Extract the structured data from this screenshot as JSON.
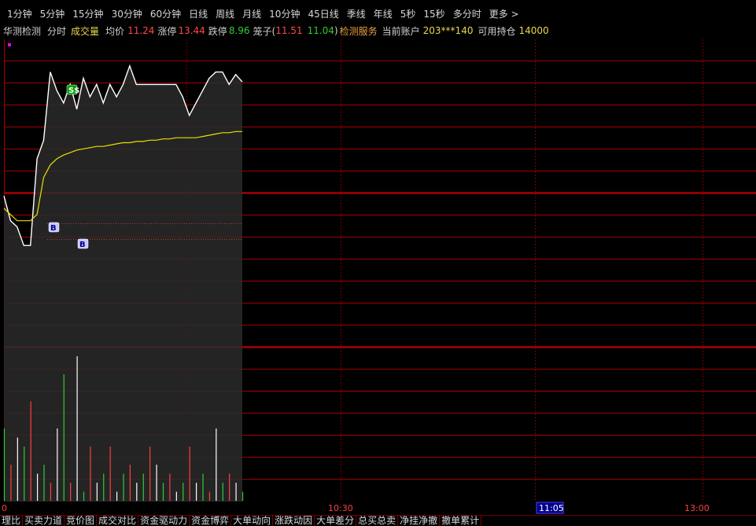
{
  "period_bar": [
    "1分钟",
    "5分钟",
    "15分钟",
    "30分钟",
    "60分钟",
    "日线",
    "周线",
    "月线",
    "10分钟",
    "45日线",
    "季线",
    "年线",
    "5秒",
    "15秒",
    "多分时",
    "更多 >"
  ],
  "info_bar": {
    "indicator": "华测检测",
    "mode": "分时",
    "volume_label": "成交量",
    "avg_label": "均价",
    "avg_value": "11.24",
    "limit_up_label": "涨停",
    "limit_up_value": "13.44",
    "limit_down_label": "跌停",
    "limit_down_value": "8.96",
    "cage_label": "笼子(",
    "cage_low": "11.51",
    "cage_high": "11.04",
    "cage_close": ")",
    "service": "检测服务",
    "account_label": "当前账户",
    "account_value": "203***140",
    "position_label": "可用持仓",
    "position_value": "14000"
  },
  "chart_markers": {
    "buy1": "B",
    "buy2": "B",
    "sell": "S$"
  },
  "time_axis": {
    "start": "0",
    "t1030": "10:30",
    "t1105": "11:05",
    "t1300": "13:00"
  },
  "bottom_tabs": [
    "理比",
    "买卖力道",
    "竞价图",
    "成交对比",
    "资金驱动力",
    "资金博弈",
    "大单动向",
    "涨跌动因",
    "大单差分",
    "总买总卖",
    "净挂净撤",
    "撤单累计"
  ],
  "chart_data": {
    "type": "line",
    "series": [
      {
        "values": [
          11.3,
          11.1,
          11.05,
          10.9,
          10.9,
          11.6,
          11.75,
          12.3,
          12.15,
          12.05,
          12.2,
          12.0,
          12.25,
          12.1,
          12.2,
          12.05,
          12.2,
          12.1,
          12.2,
          12.35,
          12.2,
          12.2,
          12.2,
          12.2,
          12.2,
          12.2,
          12.2,
          12.1,
          11.95,
          12.05,
          12.15,
          12.25,
          12.3,
          12.3,
          12.2,
          12.28,
          12.22
        ]
      },
      {
        "values": [
          11.2,
          11.15,
          11.1,
          11.1,
          11.1,
          11.15,
          11.45,
          11.55,
          11.6,
          11.63,
          11.65,
          11.67,
          11.68,
          11.69,
          11.7,
          11.7,
          11.71,
          11.72,
          11.73,
          11.73,
          11.74,
          11.74,
          11.75,
          11.75,
          11.76,
          11.76,
          11.77,
          11.77,
          11.77,
          11.77,
          11.78,
          11.79,
          11.8,
          11.81,
          11.81,
          11.82,
          11.82
        ]
      },
      {
        "values": [
          80,
          40,
          70,
          60,
          110,
          30,
          40,
          20,
          80,
          140,
          20,
          160,
          10,
          60,
          20,
          30,
          60,
          10,
          30,
          40,
          20,
          30,
          60,
          40,
          20,
          30,
          10,
          20,
          60,
          20,
          30,
          10,
          80,
          20,
          30,
          20,
          10
        ]
      }
    ],
    "colors": {
      "price": "#ffffff",
      "avg": "#e8e000",
      "grid": "#a00000",
      "up": "#ff4040",
      "down": "#33cc33",
      "flat": "#ffffff",
      "area": "#2a2a2a"
    }
  }
}
